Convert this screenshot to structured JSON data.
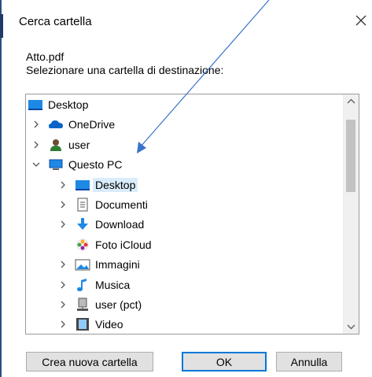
{
  "window": {
    "title": "Cerca cartella"
  },
  "file_name": "Atto.pdf",
  "instruction": "Selezionare una cartella di destinazione:",
  "tree": [
    {
      "id": "desktop-root",
      "label": "Desktop",
      "expander": "none",
      "icon": "desktop-icon"
    },
    {
      "id": "onedrive",
      "label": "OneDrive",
      "expander": "collapsed",
      "icon": "cloud-icon"
    },
    {
      "id": "user",
      "label": "user",
      "expander": "collapsed",
      "icon": "user-icon"
    },
    {
      "id": "questo-pc",
      "label": "Questo PC",
      "expander": "expanded",
      "icon": "computer-icon"
    },
    {
      "id": "desktop",
      "label": "Desktop",
      "expander": "collapsed",
      "icon": "desktop-icon",
      "selected": true
    },
    {
      "id": "documenti",
      "label": "Documenti",
      "expander": "collapsed",
      "icon": "document-icon"
    },
    {
      "id": "download",
      "label": "Download",
      "expander": "collapsed",
      "icon": "download-icon"
    },
    {
      "id": "foto-icloud",
      "label": "Foto iCloud",
      "expander": "none",
      "icon": "icloud-photos-icon"
    },
    {
      "id": "immagini",
      "label": "Immagini",
      "expander": "collapsed",
      "icon": "pictures-icon"
    },
    {
      "id": "musica",
      "label": "Musica",
      "expander": "collapsed",
      "icon": "music-icon"
    },
    {
      "id": "user-pct",
      "label": "user (pct)",
      "expander": "collapsed",
      "icon": "network-drive-icon"
    },
    {
      "id": "video",
      "label": "Video",
      "expander": "collapsed",
      "icon": "video-icon"
    }
  ],
  "buttons": {
    "new_folder": "Crea nuova cartella",
    "ok": "OK",
    "cancel": "Annulla"
  },
  "colors": {
    "accent": "#0078d7",
    "selection": "#d9ecfb",
    "annotation_arrow": "#3b73c9"
  }
}
